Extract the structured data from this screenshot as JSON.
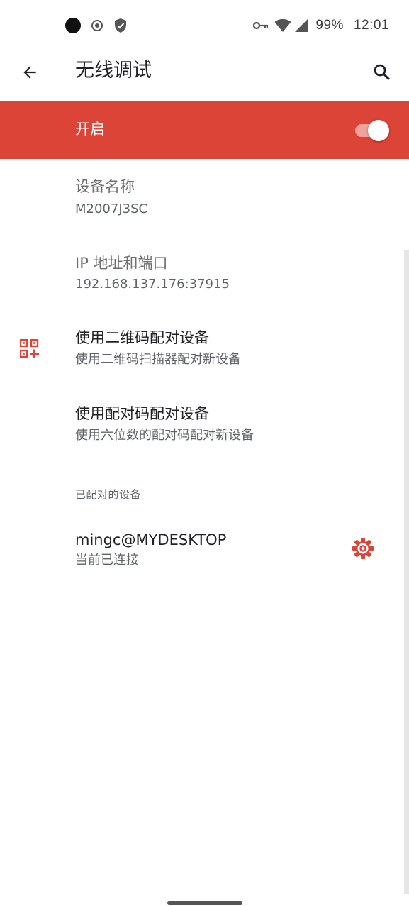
{
  "status_bar": {
    "left_icons": [
      "record-dot-icon",
      "target-circle-icon",
      "shield-icon"
    ],
    "right_icons": [
      "vpn-key-icon",
      "wifi-icon",
      "cell-signal-icon"
    ],
    "battery": "99%",
    "time": "12:01"
  },
  "app_bar": {
    "back_icon": "arrow-left-icon",
    "title": "无线调试",
    "search_icon": "search-icon"
  },
  "master_switch": {
    "label": "开启",
    "enabled": true
  },
  "info": {
    "device_name_title": "设备名称",
    "device_name_value": "M2007J3SC",
    "ip_title": "IP 地址和端口",
    "ip_value": "192.168.137.176:37915"
  },
  "pairing": {
    "qr_title": "使用二维码配对设备",
    "qr_summary": "使用二维码扫描器配对新设备",
    "code_title": "使用配对码配对设备",
    "code_summary": "使用六位数的配对码配对新设备"
  },
  "paired_devices": {
    "header": "已配对的设备",
    "items": [
      {
        "name": "mingc@MYDESKTOP",
        "status": "当前已连接"
      }
    ]
  },
  "colors": {
    "accent": "#db4437",
    "switch_track": "#f1a39b",
    "text_primary": "#202124",
    "text_secondary": "#5f6368",
    "divider": "#dcdcdc"
  }
}
